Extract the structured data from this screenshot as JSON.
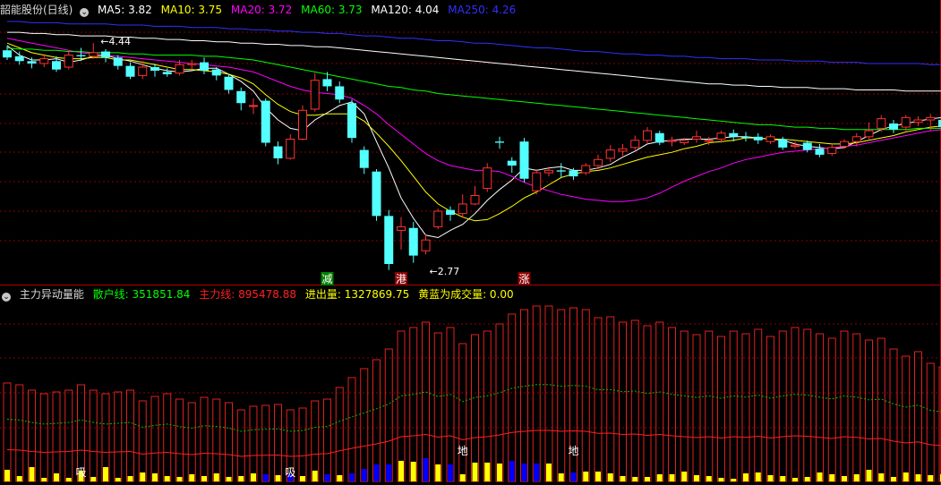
{
  "header_main": {
    "title": "韶能股份(日线)",
    "ma": [
      {
        "label": "MA5: 3.82",
        "color": "#ffffff"
      },
      {
        "label": "MA10: 3.75",
        "color": "#ffff00"
      },
      {
        "label": "MA20: 3.72",
        "color": "#ff00ff"
      },
      {
        "label": "MA60: 3.73",
        "color": "#00ff00"
      },
      {
        "label": "MA120: 4.04",
        "color": "#ffffff"
      },
      {
        "label": "MA250: 4.26",
        "color": "#3030ff"
      }
    ]
  },
  "header_sub": {
    "title": "主力异动量能",
    "items": [
      {
        "label": "散户线: 351851.84",
        "color": "#00ff00"
      },
      {
        "label": "主力线: 895478.88",
        "color": "#ff2020"
      },
      {
        "label": "进出量: 1327869.75",
        "color": "#ffff00"
      },
      {
        "label": "黄蓝为成交量: 0.00",
        "color": "#ffff00"
      }
    ]
  },
  "colors": {
    "up": "#ff3232",
    "down": "#54ffff",
    "grid": "#8b0000",
    "volYellow": "#ffff00",
    "volBlue": "#0000ff"
  },
  "chart_data": {
    "type": "candlestick",
    "price_range": [
      2.6,
      4.65
    ],
    "candles": [
      [
        4.38,
        4.32,
        4.42,
        4.3
      ],
      [
        4.33,
        4.29,
        4.37,
        4.26
      ],
      [
        4.29,
        4.27,
        4.32,
        4.23
      ],
      [
        4.27,
        4.31,
        4.35,
        4.24
      ],
      [
        4.29,
        4.22,
        4.33,
        4.2
      ],
      [
        4.24,
        4.34,
        4.38,
        4.22
      ],
      [
        4.34,
        4.33,
        4.4,
        4.29
      ],
      [
        4.33,
        4.36,
        4.44,
        4.31
      ],
      [
        4.37,
        4.32,
        4.39,
        4.28
      ],
      [
        4.32,
        4.25,
        4.34,
        4.22
      ],
      [
        4.25,
        4.16,
        4.28,
        4.14
      ],
      [
        4.17,
        4.24,
        4.29,
        4.14
      ],
      [
        4.24,
        4.21,
        4.27,
        4.16
      ],
      [
        4.2,
        4.18,
        4.23,
        4.16
      ],
      [
        4.19,
        4.26,
        4.3,
        4.17
      ],
      [
        4.26,
        4.27,
        4.3,
        4.22
      ],
      [
        4.28,
        4.21,
        4.32,
        4.18
      ],
      [
        4.22,
        4.17,
        4.24,
        4.13
      ],
      [
        4.16,
        4.05,
        4.18,
        4.02
      ],
      [
        4.04,
        3.94,
        4.07,
        3.88
      ],
      [
        3.92,
        3.92,
        3.98,
        3.85
      ],
      [
        3.96,
        3.61,
        3.98,
        3.58
      ],
      [
        3.58,
        3.48,
        3.62,
        3.43
      ],
      [
        3.48,
        3.64,
        3.68,
        3.47
      ],
      [
        3.64,
        3.88,
        3.92,
        3.63
      ],
      [
        3.89,
        4.13,
        4.19,
        3.87
      ],
      [
        4.14,
        4.08,
        4.2,
        4.04
      ],
      [
        4.08,
        3.97,
        4.12,
        3.94
      ],
      [
        3.94,
        3.65,
        3.97,
        3.61
      ],
      [
        3.55,
        3.4,
        3.58,
        3.35
      ],
      [
        3.37,
        3.0,
        3.39,
        2.96
      ],
      [
        3.0,
        2.6,
        3.05,
        2.55
      ],
      [
        2.88,
        2.91,
        2.99,
        2.72
      ],
      [
        2.9,
        2.67,
        2.95,
        2.61
      ],
      [
        2.71,
        2.8,
        2.85,
        2.68
      ],
      [
        2.91,
        3.04,
        3.06,
        2.89
      ],
      [
        3.05,
        3.01,
        3.08,
        2.96
      ],
      [
        3.02,
        3.1,
        3.18,
        2.99
      ],
      [
        3.1,
        3.17,
        3.25,
        3.09
      ],
      [
        3.23,
        3.4,
        3.44,
        3.2
      ],
      [
        3.62,
        3.61,
        3.66,
        3.56
      ],
      [
        3.46,
        3.42,
        3.49,
        3.36
      ],
      [
        3.62,
        3.31,
        3.65,
        3.28
      ],
      [
        3.21,
        3.36,
        3.39,
        3.18
      ],
      [
        3.36,
        3.38,
        3.41,
        3.33
      ],
      [
        3.38,
        3.37,
        3.44,
        3.32
      ],
      [
        3.38,
        3.33,
        3.4,
        3.3
      ],
      [
        3.36,
        3.42,
        3.44,
        3.34
      ],
      [
        3.42,
        3.47,
        3.51,
        3.39
      ],
      [
        3.48,
        3.55,
        3.59,
        3.45
      ],
      [
        3.54,
        3.56,
        3.6,
        3.5
      ],
      [
        3.57,
        3.63,
        3.67,
        3.55
      ],
      [
        3.63,
        3.71,
        3.74,
        3.6
      ],
      [
        3.69,
        3.61,
        3.71,
        3.59
      ],
      [
        3.62,
        3.63,
        3.66,
        3.58
      ],
      [
        3.61,
        3.63,
        3.65,
        3.59
      ],
      [
        3.64,
        3.66,
        3.71,
        3.61
      ],
      [
        3.63,
        3.63,
        3.66,
        3.59
      ],
      [
        3.64,
        3.69,
        3.71,
        3.61
      ],
      [
        3.69,
        3.66,
        3.72,
        3.62
      ],
      [
        3.66,
        3.65,
        3.7,
        3.62
      ],
      [
        3.66,
        3.63,
        3.69,
        3.6
      ],
      [
        3.62,
        3.66,
        3.68,
        3.6
      ],
      [
        3.64,
        3.57,
        3.66,
        3.55
      ],
      [
        3.58,
        3.59,
        3.62,
        3.56
      ],
      [
        3.61,
        3.55,
        3.63,
        3.53
      ],
      [
        3.56,
        3.51,
        3.6,
        3.49
      ],
      [
        3.52,
        3.57,
        3.6,
        3.5
      ],
      [
        3.58,
        3.62,
        3.64,
        3.56
      ],
      [
        3.62,
        3.66,
        3.69,
        3.58
      ],
      [
        3.66,
        3.71,
        3.78,
        3.64
      ],
      [
        3.73,
        3.81,
        3.84,
        3.7
      ],
      [
        3.77,
        3.72,
        3.8,
        3.69
      ],
      [
        3.74,
        3.82,
        3.84,
        3.71
      ],
      [
        3.78,
        3.8,
        3.83,
        3.75
      ],
      [
        3.8,
        3.82,
        3.85,
        3.71
      ],
      [
        3.8,
        3.74,
        3.82,
        3.71
      ]
    ],
    "volume": [
      13,
      6,
      16,
      4,
      9,
      4,
      12,
      5,
      16,
      4,
      6,
      10,
      9,
      6,
      5,
      8,
      6,
      9,
      5,
      6,
      9,
      8,
      7,
      8,
      6,
      12,
      8,
      7,
      9,
      14,
      19,
      19,
      23,
      22,
      26,
      19,
      19,
      8,
      21,
      21,
      20,
      23,
      20,
      20,
      20,
      9,
      10,
      11,
      11,
      9,
      6,
      5,
      5,
      8,
      8,
      11,
      7,
      6,
      4,
      3,
      9,
      10,
      7,
      6,
      4,
      5,
      10,
      8,
      6,
      8,
      13,
      9,
      5,
      10,
      8,
      7,
      8
    ],
    "volume_blue_indices": [
      21,
      23,
      26,
      28,
      29,
      30,
      31,
      34,
      36,
      41,
      42,
      43,
      46
    ],
    "signal_bars": [
      110,
      108,
      102,
      98,
      100,
      102,
      108,
      102,
      98,
      100,
      102,
      90,
      95,
      98,
      92,
      88,
      94,
      92,
      88,
      80,
      84,
      85,
      86,
      80,
      82,
      90,
      92,
      105,
      116,
      126,
      136,
      148,
      168,
      172,
      178,
      166,
      172,
      154,
      164,
      168,
      176,
      187,
      192,
      196,
      196,
      192,
      194,
      192,
      183,
      184,
      178,
      180,
      174,
      178,
      172,
      168,
      164,
      168,
      162,
      168,
      165,
      170,
      162,
      168,
      172,
      170,
      165,
      160,
      168,
      165,
      158,
      160,
      148,
      140,
      145,
      132,
      128
    ],
    "ma_values": {
      "MA5": [
        4.42,
        4.34,
        4.3,
        4.3,
        4.31,
        4.28,
        4.3,
        4.33,
        4.34,
        4.31,
        4.29,
        4.26,
        4.23,
        4.21,
        4.2,
        4.21,
        4.23,
        4.23,
        4.18,
        4.12,
        4.04,
        3.9,
        3.8,
        3.73,
        3.71,
        3.8,
        3.86,
        3.92,
        3.95,
        3.85,
        3.62,
        3.4,
        3.15,
        2.98,
        2.84,
        2.82,
        2.88,
        2.93,
        3.02,
        3.13,
        3.22,
        3.3,
        3.4,
        3.38,
        3.4,
        3.41,
        3.38,
        3.38,
        3.4,
        3.43,
        3.49,
        3.54,
        3.6,
        3.62,
        3.63,
        3.64,
        3.64,
        3.64,
        3.65,
        3.66,
        3.66,
        3.65,
        3.64,
        3.63,
        3.6,
        3.58,
        3.57,
        3.56,
        3.57,
        3.62,
        3.67,
        3.72,
        3.75,
        3.77,
        3.79,
        3.81,
        3.82
      ],
      "MA10": [
        4.44,
        4.4,
        4.36,
        4.34,
        4.32,
        4.31,
        4.31,
        4.32,
        4.32,
        4.3,
        4.3,
        4.28,
        4.26,
        4.24,
        4.22,
        4.22,
        4.21,
        4.2,
        4.18,
        4.15,
        4.1,
        4.01,
        3.93,
        3.87,
        3.84,
        3.84,
        3.85,
        3.85,
        3.85,
        3.79,
        3.69,
        3.58,
        3.46,
        3.33,
        3.2,
        3.1,
        3.04,
        2.99,
        2.96,
        2.97,
        3.02,
        3.08,
        3.15,
        3.2,
        3.26,
        3.32,
        3.35,
        3.37,
        3.38,
        3.4,
        3.43,
        3.46,
        3.49,
        3.51,
        3.53,
        3.56,
        3.58,
        3.61,
        3.62,
        3.63,
        3.65,
        3.65,
        3.64,
        3.64,
        3.63,
        3.62,
        3.61,
        3.6,
        3.6,
        3.61,
        3.63,
        3.65,
        3.67,
        3.7,
        3.72,
        3.74,
        3.75
      ],
      "MA20": [
        4.48,
        4.46,
        4.44,
        4.42,
        4.4,
        4.38,
        4.36,
        4.35,
        4.34,
        4.33,
        4.32,
        4.31,
        4.3,
        4.29,
        4.28,
        4.27,
        4.26,
        4.25,
        4.24,
        4.22,
        4.2,
        4.16,
        4.12,
        4.08,
        4.05,
        4.03,
        4.02,
        4.01,
        3.98,
        3.92,
        3.85,
        3.76,
        3.68,
        3.6,
        3.52,
        3.46,
        3.42,
        3.4,
        3.38,
        3.38,
        3.37,
        3.33,
        3.28,
        3.24,
        3.21,
        3.18,
        3.16,
        3.14,
        3.13,
        3.12,
        3.12,
        3.13,
        3.15,
        3.19,
        3.24,
        3.29,
        3.33,
        3.37,
        3.4,
        3.44,
        3.47,
        3.49,
        3.51,
        3.53,
        3.54,
        3.55,
        3.56,
        3.57,
        3.58,
        3.59,
        3.61,
        3.63,
        3.65,
        3.67,
        3.69,
        3.71,
        3.72
      ],
      "MA60": [
        4.4,
        4.39,
        4.39,
        4.38,
        4.38,
        4.37,
        4.37,
        4.36,
        4.36,
        4.36,
        4.35,
        4.35,
        4.34,
        4.34,
        4.34,
        4.34,
        4.33,
        4.33,
        4.32,
        4.31,
        4.3,
        4.28,
        4.26,
        4.24,
        4.22,
        4.2,
        4.18,
        4.16,
        4.14,
        4.12,
        4.1,
        4.08,
        4.07,
        4.05,
        4.04,
        4.02,
        4.01,
        4.0,
        3.99,
        3.98,
        3.97,
        3.96,
        3.95,
        3.94,
        3.93,
        3.92,
        3.91,
        3.9,
        3.89,
        3.88,
        3.87,
        3.86,
        3.85,
        3.84,
        3.83,
        3.82,
        3.81,
        3.8,
        3.79,
        3.78,
        3.77,
        3.76,
        3.76,
        3.75,
        3.74,
        3.74,
        3.73,
        3.73,
        3.72,
        3.72,
        3.72,
        3.72,
        3.72,
        3.72,
        3.73,
        3.73,
        3.73
      ],
      "MA120": [
        4.53,
        4.53,
        4.52,
        4.52,
        4.51,
        4.51,
        4.5,
        4.5,
        4.5,
        4.49,
        4.49,
        4.48,
        4.48,
        4.47,
        4.47,
        4.46,
        4.46,
        4.45,
        4.45,
        4.44,
        4.44,
        4.43,
        4.43,
        4.42,
        4.42,
        4.41,
        4.41,
        4.4,
        4.39,
        4.38,
        4.37,
        4.36,
        4.35,
        4.34,
        4.33,
        4.32,
        4.31,
        4.3,
        4.29,
        4.28,
        4.27,
        4.26,
        4.25,
        4.24,
        4.23,
        4.22,
        4.21,
        4.2,
        4.19,
        4.18,
        4.17,
        4.16,
        4.15,
        4.14,
        4.13,
        4.12,
        4.11,
        4.1,
        4.1,
        4.09,
        4.09,
        4.08,
        4.08,
        4.07,
        4.07,
        4.07,
        4.06,
        4.06,
        4.06,
        4.05,
        4.05,
        4.05,
        4.05,
        4.04,
        4.04,
        4.04,
        4.04
      ],
      "MA250": [
        4.62,
        4.62,
        4.61,
        4.61,
        4.61,
        4.6,
        4.6,
        4.6,
        4.6,
        4.59,
        4.59,
        4.59,
        4.58,
        4.58,
        4.58,
        4.57,
        4.57,
        4.57,
        4.56,
        4.56,
        4.55,
        4.55,
        4.54,
        4.54,
        4.53,
        4.53,
        4.52,
        4.52,
        4.51,
        4.5,
        4.5,
        4.49,
        4.48,
        4.48,
        4.47,
        4.46,
        4.46,
        4.45,
        4.44,
        4.44,
        4.43,
        4.42,
        4.41,
        4.4,
        4.4,
        4.39,
        4.38,
        4.37,
        4.37,
        4.36,
        4.35,
        4.35,
        4.34,
        4.34,
        4.33,
        4.33,
        4.32,
        4.32,
        4.31,
        4.31,
        4.31,
        4.3,
        4.3,
        4.3,
        4.29,
        4.29,
        4.29,
        4.28,
        4.28,
        4.28,
        4.27,
        4.27,
        4.27,
        4.27,
        4.27,
        4.26,
        4.26
      ]
    },
    "annotations": {
      "high_label": "4.44",
      "low_label": "2.77",
      "markers": [
        {
          "text": "减",
          "index": 26,
          "bg": "#008000"
        },
        {
          "text": "港",
          "index": 32,
          "bg": "#8b0000"
        },
        {
          "text": "涨",
          "index": 42,
          "bg": "#8b0000"
        }
      ],
      "sub_marks": [
        {
          "text": "吸",
          "index": 6
        },
        {
          "text": "吸",
          "index": 23
        },
        {
          "text": "地",
          "index": 37
        },
        {
          "text": "地",
          "index": 46
        }
      ]
    }
  }
}
